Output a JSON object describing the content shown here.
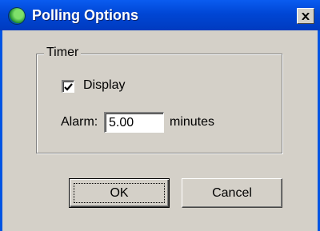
{
  "window": {
    "title": "Polling Options",
    "close_label": "×"
  },
  "timer_group": {
    "legend": "Timer",
    "display_checkbox": {
      "label": "Display",
      "checked": true,
      "mark": "✔"
    },
    "alarm": {
      "label": "Alarm:",
      "value": "5.00",
      "units": "minutes"
    }
  },
  "buttons": {
    "ok_label": "OK",
    "cancel_label": "Cancel"
  },
  "icons": {
    "app": "globe-icon",
    "close": "close-icon",
    "check": "checkmark-icon"
  },
  "colors": {
    "titlebar": "#0046d5",
    "dialog_face": "#d4d0c8"
  }
}
